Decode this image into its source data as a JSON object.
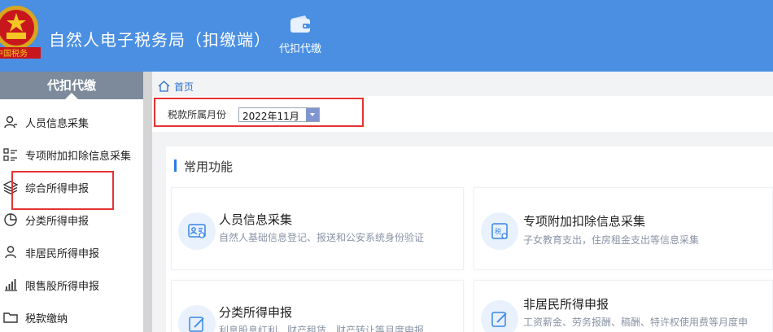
{
  "header": {
    "title": "自然人电子税务局（扣缴端）",
    "nav": [
      {
        "label": "代扣代缴",
        "icon": "wallet-icon"
      }
    ]
  },
  "sidebar": {
    "heading": "代扣代缴",
    "items": [
      {
        "label": "人员信息采集",
        "icon": "person-icon"
      },
      {
        "label": "专项附加扣除信息采集",
        "icon": "list-icon"
      },
      {
        "label": "综合所得申报",
        "icon": "layers-icon"
      },
      {
        "label": "分类所得申报",
        "icon": "pie-chart-icon"
      },
      {
        "label": "非居民所得申报",
        "icon": "person-outline-icon"
      },
      {
        "label": "限售股所得申报",
        "icon": "bar-chart-icon"
      },
      {
        "label": "税款缴纳",
        "icon": "folder-icon"
      }
    ]
  },
  "breadcrumb": {
    "home": "首页"
  },
  "filter": {
    "label": "税款所属月份",
    "month": "2022年11月"
  },
  "section": {
    "title": "常用功能"
  },
  "cards": [
    {
      "title": "人员信息采集",
      "desc": "自然人基础信息登记、报送和公安系统身份验证",
      "icon": "id-card-icon"
    },
    {
      "title": "专项附加扣除信息采集",
      "desc": "子女教育支出，住房租金支出等信息采集",
      "icon": "tax-form-icon"
    },
    {
      "title": "分类所得申报",
      "desc": "利息股息红利、财产租赁、财产转让等月度申报",
      "icon": "edit-icon"
    },
    {
      "title": "非居民所得申报",
      "desc": "工资薪金、劳务报酬、稿酬、特许权使用费等月度申",
      "icon": "edit-icon"
    }
  ],
  "colors": {
    "header": "#4a8fe2",
    "accent": "#2a7ae2",
    "annotation": "#e53333"
  }
}
